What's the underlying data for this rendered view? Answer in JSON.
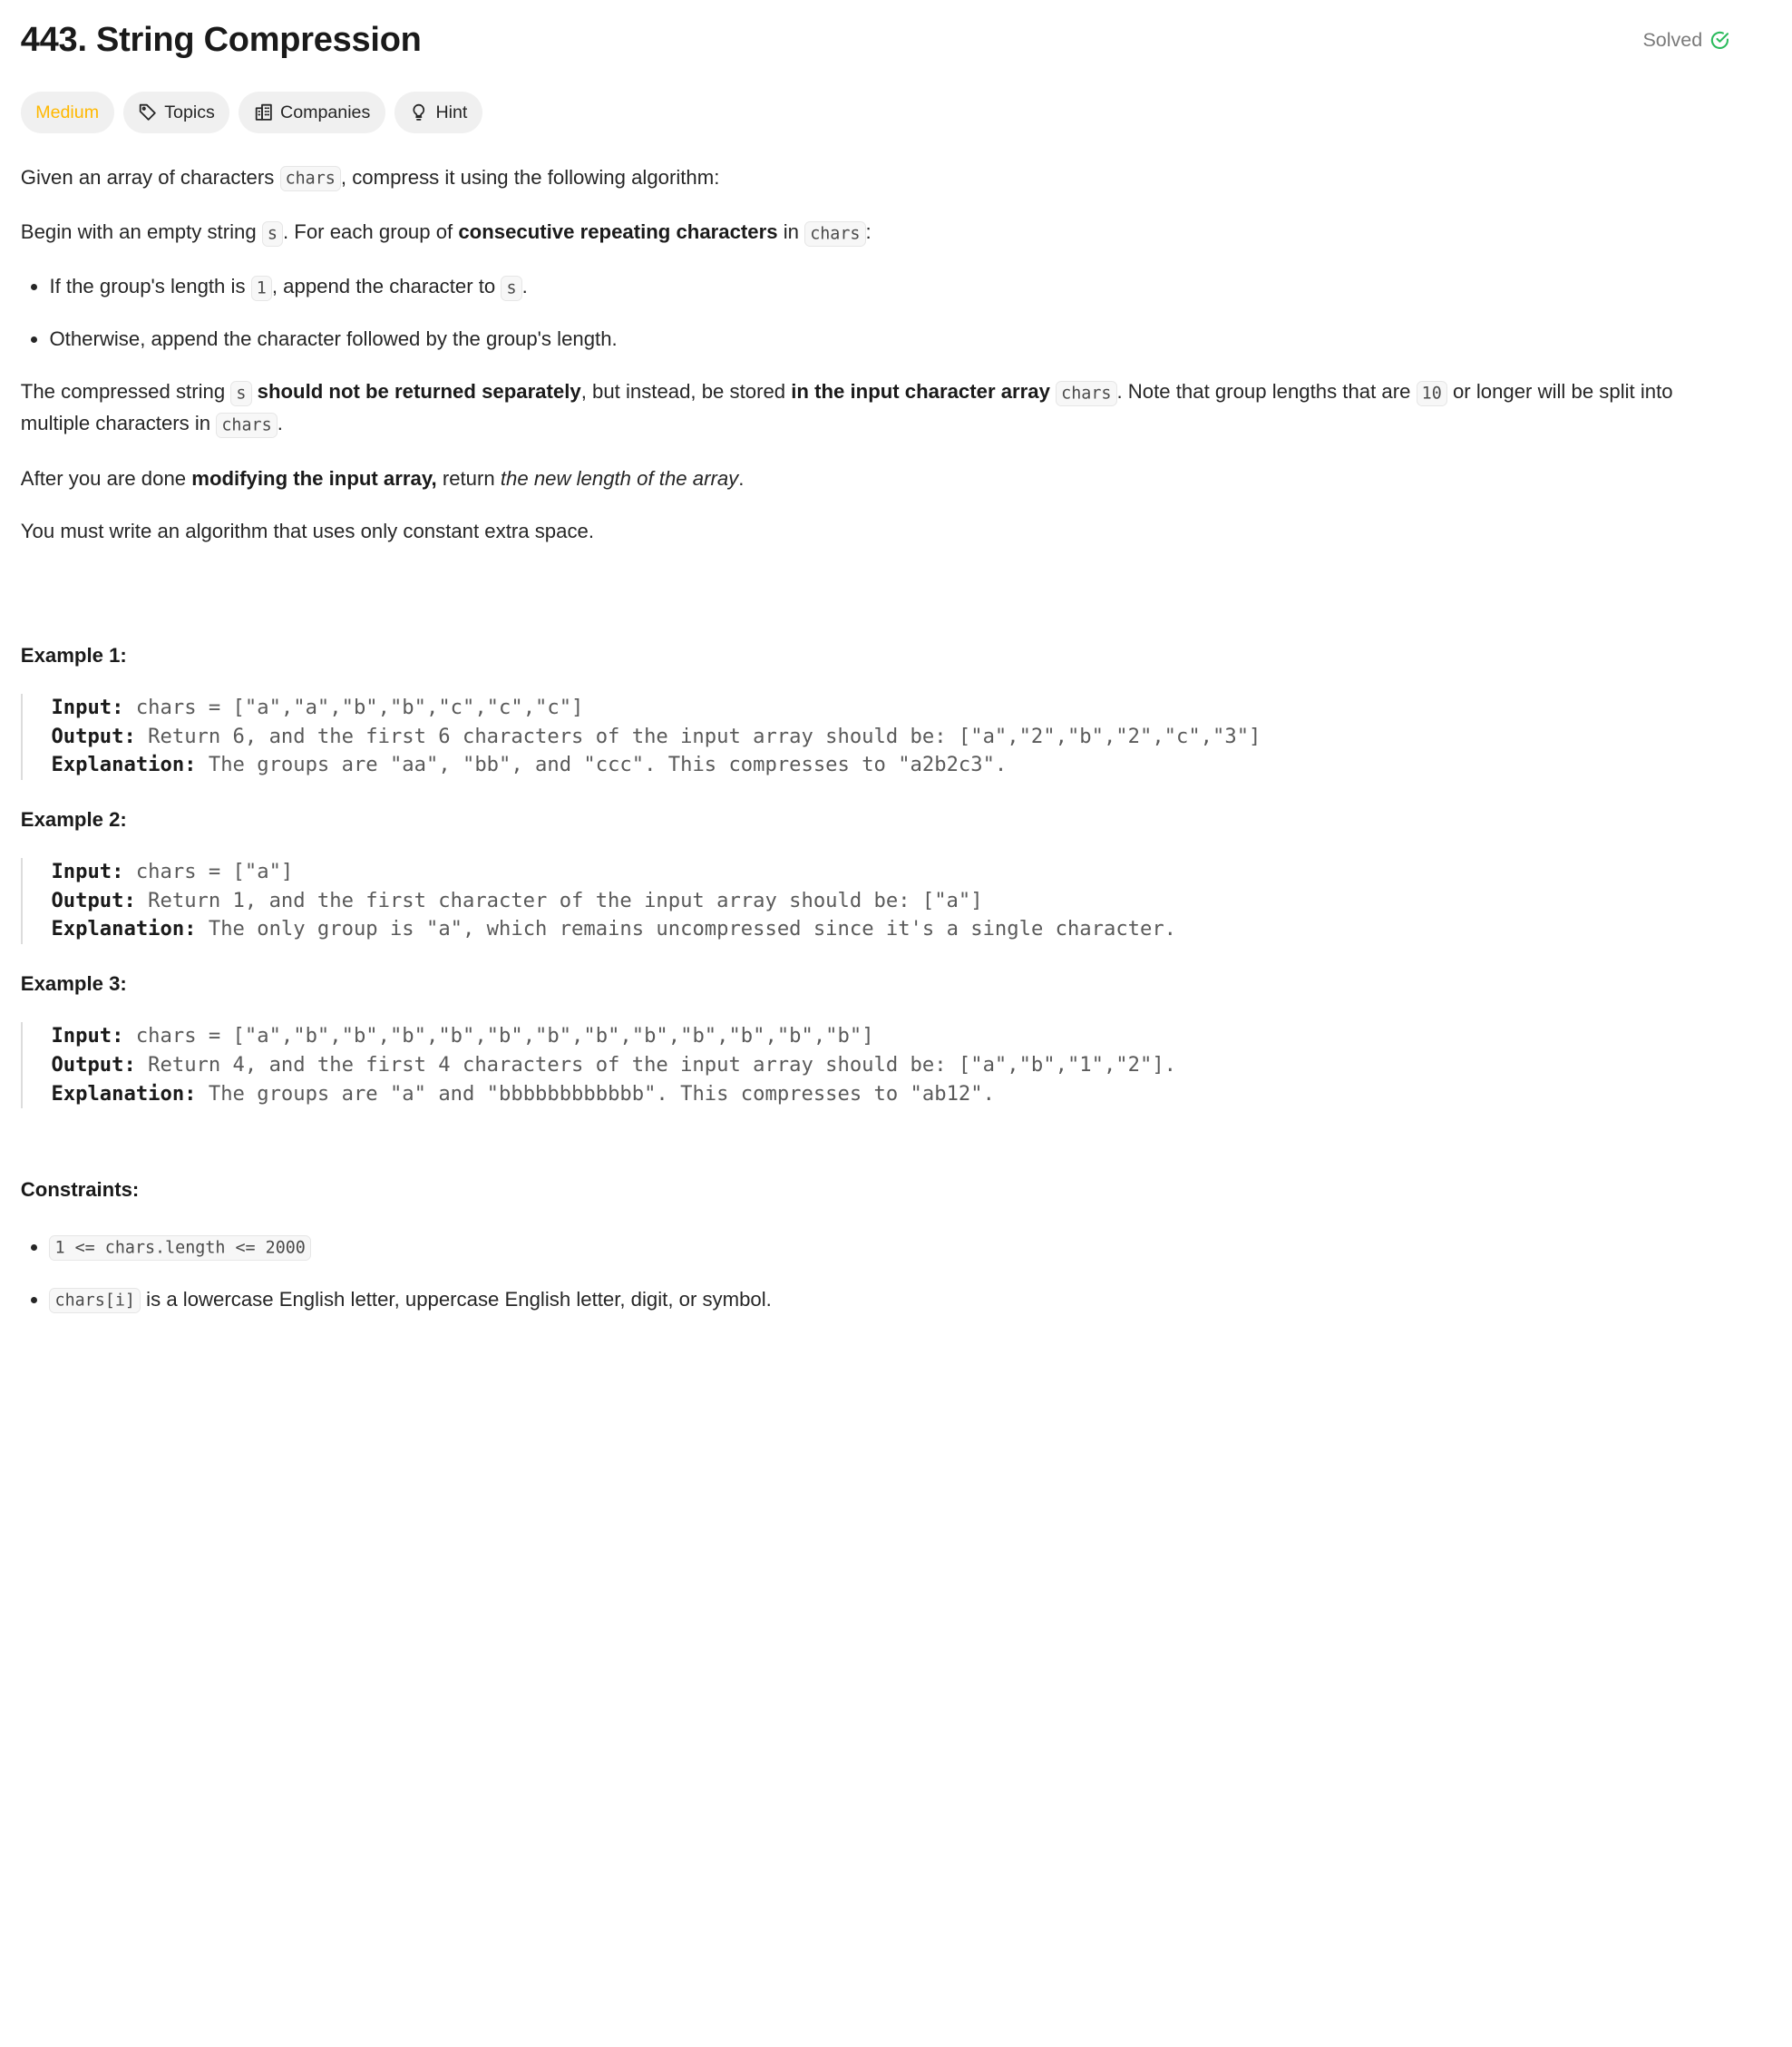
{
  "problem": {
    "title": "443. String Compression",
    "status": "Solved"
  },
  "tags": {
    "difficulty": "Medium",
    "topics": "Topics",
    "companies": "Companies",
    "hint": "Hint"
  },
  "description": {
    "p1_a": "Given an array of characters ",
    "p1_code": "chars",
    "p1_b": ", compress it using the following algorithm:",
    "p2_a": "Begin with an empty string ",
    "p2_code1": "s",
    "p2_b": ". For each group of ",
    "p2_bold": "consecutive repeating characters",
    "p2_c": " in ",
    "p2_code2": "chars",
    "p2_d": ":",
    "li1_a": "If the group's length is ",
    "li1_code1": "1",
    "li1_b": ", append the character to ",
    "li1_code2": "s",
    "li1_c": ".",
    "li2": "Otherwise, append the character followed by the group's length.",
    "p3_a": "The compressed string ",
    "p3_code1": "s",
    "p3_bold1": "should not be returned separately",
    "p3_b": ", but instead, be stored ",
    "p3_bold2": "in the input character array",
    "p3_code2": "chars",
    "p3_c": ". Note that group lengths that are ",
    "p3_code3": "10",
    "p3_d": " or longer will be split into multiple characters in ",
    "p3_code4": "chars",
    "p3_e": ".",
    "p4_a": "After you are done ",
    "p4_bold": "modifying the input array,",
    "p4_b": " return ",
    "p4_em": "the new length of the array",
    "p4_c": ".",
    "p5": "You must write an algorithm that uses only constant extra space."
  },
  "examples": [
    {
      "title": "Example 1:",
      "input_label": "Input:",
      "input": "chars = [\"a\",\"a\",\"b\",\"b\",\"c\",\"c\",\"c\"]",
      "output_label": "Output:",
      "output": "Return 6, and the first 6 characters of the input array should be: [\"a\",\"2\",\"b\",\"2\",\"c\",\"3\"]",
      "explanation_label": "Explanation:",
      "explanation": "The groups are \"aa\", \"bb\", and \"ccc\". This compresses to \"a2b2c3\"."
    },
    {
      "title": "Example 2:",
      "input_label": "Input:",
      "input": "chars = [\"a\"]",
      "output_label": "Output:",
      "output": "Return 1, and the first character of the input array should be: [\"a\"]",
      "explanation_label": "Explanation:",
      "explanation": "The only group is \"a\", which remains uncompressed since it's a single character."
    },
    {
      "title": "Example 3:",
      "input_label": "Input:",
      "input": "chars = [\"a\",\"b\",\"b\",\"b\",\"b\",\"b\",\"b\",\"b\",\"b\",\"b\",\"b\",\"b\",\"b\"]",
      "output_label": "Output:",
      "output": "Return 4, and the first 4 characters of the input array should be: [\"a\",\"b\",\"1\",\"2\"].",
      "explanation_label": "Explanation:",
      "explanation": "The groups are \"a\" and \"bbbbbbbbbbbb\". This compresses to \"ab12\"."
    }
  ],
  "constraints": {
    "title": "Constraints:",
    "c1_code": "1 <= chars.length <= 2000",
    "c2_code": "chars[i]",
    "c2_text": " is a lowercase English letter, uppercase English letter, digit, or symbol."
  },
  "colors": {
    "medium": "#ffb800",
    "solved_check": "#2cbb5d"
  },
  "icons": {
    "solved": "check-circle-icon",
    "topics": "tag-icon",
    "companies": "building-icon",
    "hint": "lightbulb-icon"
  }
}
